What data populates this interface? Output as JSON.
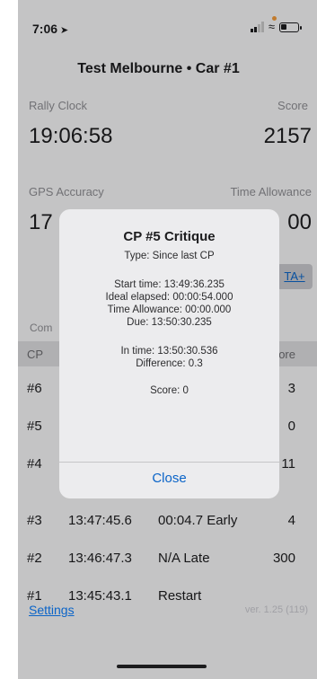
{
  "status_bar": {
    "time": "7:06"
  },
  "header": {
    "title": "Test Melbourne  •  Car #1"
  },
  "rally_clock": {
    "label": "Rally Clock",
    "value": "19:06:58"
  },
  "score": {
    "label": "Score",
    "value": "2157"
  },
  "gps_accuracy": {
    "label": "GPS Accuracy",
    "value": "17"
  },
  "time_allowance": {
    "label": "Time Allowance",
    "value": "00"
  },
  "adjust_button": {
    "label": "TA+"
  },
  "section": {
    "header": "Com"
  },
  "table": {
    "columns": {
      "cp": "CP",
      "score": "ore"
    },
    "rows": [
      {
        "cp": "#6",
        "time": "",
        "diff": "",
        "score": "3"
      },
      {
        "cp": "#5",
        "time": "",
        "diff": "",
        "score": "0"
      },
      {
        "cp": "#4",
        "time": "",
        "diff": "",
        "score": "11"
      },
      {
        "cp": "#3",
        "time": "13:47:45.6",
        "diff": "00:04.7 Early",
        "score": "4"
      },
      {
        "cp": "#2",
        "time": "13:46:47.3",
        "diff": "N/A Late",
        "score": "300"
      },
      {
        "cp": "#1",
        "time": "13:45:43.1",
        "diff": "Restart",
        "score": ""
      }
    ]
  },
  "footer": {
    "settings": "Settings",
    "version": "ver. 1.25 (119)"
  },
  "dialog": {
    "title": "CP #5 Critique",
    "type": "Type: Since last CP",
    "start_time": "Start time: 13:49:36.235",
    "ideal_elapsed": "Ideal elapsed: 00:00:54.000",
    "time_allowance": "Time Allowance: 00:00.000",
    "due": "Due: 13:50:30.235",
    "in_time": "In time: 13:50:30.536",
    "difference": "Difference: 0.3",
    "score": "Score:  0",
    "close": "Close"
  }
}
